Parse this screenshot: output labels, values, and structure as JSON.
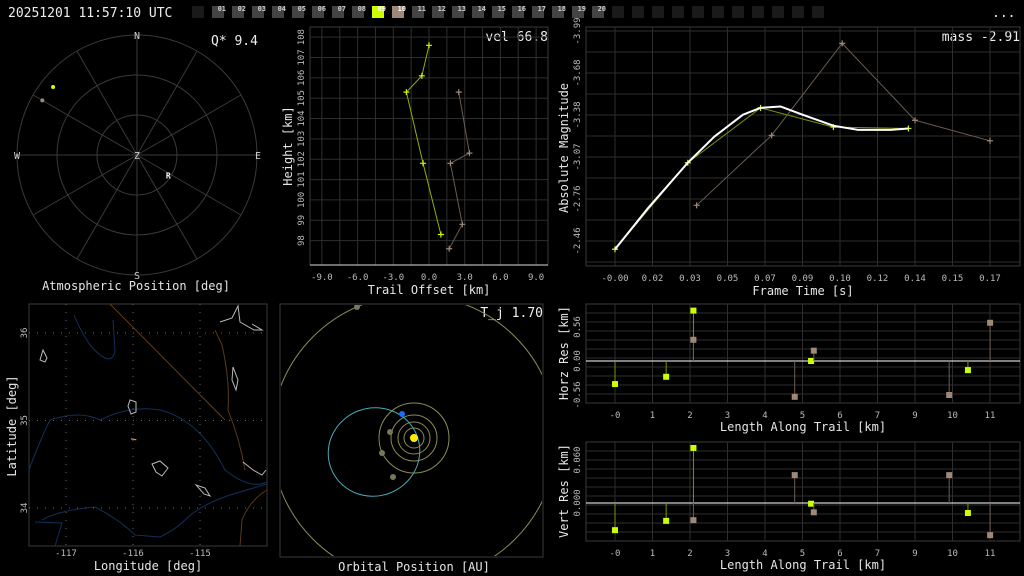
{
  "header": {
    "timestamp": "20251201 11:57:10 UTC",
    "menu_label": "...",
    "cameras": [
      {
        "label": "",
        "state": "empty"
      },
      {
        "label": "01",
        "state": "idle"
      },
      {
        "label": "02",
        "state": "idle"
      },
      {
        "label": "03",
        "state": "idle"
      },
      {
        "label": "04",
        "state": "idle"
      },
      {
        "label": "05",
        "state": "idle"
      },
      {
        "label": "06",
        "state": "idle"
      },
      {
        "label": "07",
        "state": "idle"
      },
      {
        "label": "08",
        "state": "idle"
      },
      {
        "label": "09",
        "state": "primary"
      },
      {
        "label": "10",
        "state": "secondary"
      },
      {
        "label": "11",
        "state": "idle"
      },
      {
        "label": "12",
        "state": "idle"
      },
      {
        "label": "13",
        "state": "idle"
      },
      {
        "label": "14",
        "state": "idle"
      },
      {
        "label": "15",
        "state": "idle"
      },
      {
        "label": "16",
        "state": "idle"
      },
      {
        "label": "17",
        "state": "idle"
      },
      {
        "label": "18",
        "state": "idle"
      },
      {
        "label": "19",
        "state": "idle"
      },
      {
        "label": "20",
        "state": "idle"
      },
      {
        "label": "",
        "state": "empty"
      },
      {
        "label": "",
        "state": "empty"
      },
      {
        "label": "",
        "state": "empty"
      },
      {
        "label": "",
        "state": "empty"
      },
      {
        "label": "",
        "state": "empty"
      },
      {
        "label": "",
        "state": "empty"
      },
      {
        "label": "",
        "state": "empty"
      },
      {
        "label": "",
        "state": "empty"
      },
      {
        "label": "",
        "state": "empty"
      },
      {
        "label": "",
        "state": "empty"
      },
      {
        "label": "",
        "state": "empty"
      }
    ]
  },
  "colors": {
    "primary": "#ccff00",
    "secondary": "#a08878",
    "fit": "#ffffff",
    "grid": "#2e2e2e",
    "orbit": "#8c8c55",
    "comet": "#4aa8b8",
    "earth": "#1a6cff",
    "sun": "#ffee00"
  },
  "chart_data": [
    {
      "id": "polar",
      "type": "scatter",
      "title": "Atmospheric Position [deg]",
      "stat_label": "Q*  9.4",
      "cardinals": {
        "n": "N",
        "s": "S",
        "e": "E",
        "w": "W",
        "zenith": "Z"
      },
      "station_label": "R",
      "station": {
        "azimuth": 123,
        "zenith_angle": 28
      },
      "series": [
        {
          "name": "09",
          "azimuth": [
            309
          ],
          "zenith_angle": [
            81
          ]
        },
        {
          "name": "10",
          "azimuth": [
            300
          ],
          "zenith_angle": [
            82
          ]
        }
      ]
    },
    {
      "id": "trail",
      "type": "line",
      "title": "",
      "stat_label": "vel 66.8",
      "xlabel": "Trail Offset [km]",
      "ylabel": "Height [km]",
      "xlim": [
        -10,
        10
      ],
      "ylim": [
        96.8,
        108.5
      ],
      "xticks": [
        "-9.0",
        "-6.0",
        "-3.0",
        "0.0",
        "3.0",
        "6.0",
        "9.0"
      ],
      "xtick_values": [
        -9,
        -6,
        -3,
        0,
        3,
        6,
        9
      ],
      "yticks": [
        "98",
        "99",
        "100",
        "101",
        "102",
        "103",
        "104",
        "105",
        "106",
        "107",
        "108"
      ],
      "ytick_values": [
        98,
        99,
        100,
        101,
        102,
        103,
        104,
        105,
        106,
        107,
        108
      ],
      "series": [
        {
          "name": "09",
          "x": [
            0.0,
            -0.6,
            -1.9,
            -0.5,
            1.0
          ],
          "y": [
            107.6,
            106.1,
            105.3,
            101.8,
            98.3
          ]
        },
        {
          "name": "10",
          "x": [
            2.5,
            3.4,
            1.8,
            2.8,
            1.7
          ],
          "y": [
            105.3,
            102.3,
            101.8,
            98.8,
            97.6
          ]
        }
      ]
    },
    {
      "id": "magnitude",
      "type": "line",
      "stat_label": "mass -2.91",
      "xlabel": "Frame Time [s]",
      "ylabel": "Absolute Magnitude",
      "xticks": [
        "-0.00",
        "0.02",
        "0.03",
        "0.05",
        "0.07",
        "0.09",
        "0.10",
        "0.12",
        "0.14",
        "0.15",
        "0.17"
      ],
      "yticks": [
        "-3.99",
        "-3.68",
        "-3.38",
        "-3.07",
        "-2.76",
        "-2.46"
      ],
      "xlim": [
        -0.013,
        0.184
      ],
      "ylim": [
        -4.0,
        -2.33
      ],
      "series": [
        {
          "name": "09",
          "x": [
            0.0,
            0.033,
            0.066,
            0.099,
            0.133
          ],
          "y": [
            -2.4,
            -3.03,
            -3.43,
            -3.29,
            -3.28
          ]
        },
        {
          "name": "10",
          "x": [
            0.037,
            0.071,
            0.103,
            0.136,
            0.17
          ],
          "y": [
            -2.72,
            -3.23,
            -3.9,
            -3.34,
            -3.19
          ]
        },
        {
          "name": "fit",
          "x": [
            0.0,
            0.015,
            0.033,
            0.045,
            0.058,
            0.066,
            0.075,
            0.085,
            0.099,
            0.11,
            0.125,
            0.133
          ],
          "y": [
            -2.4,
            -2.7,
            -3.03,
            -3.22,
            -3.38,
            -3.43,
            -3.44,
            -3.38,
            -3.3,
            -3.27,
            -3.27,
            -3.28
          ]
        }
      ]
    },
    {
      "id": "horz_res",
      "type": "scatter",
      "xlabel": "Length Along Trail [km]",
      "ylabel": "Horz Res [km]",
      "xticks": [
        "-0",
        "1",
        "2",
        "3",
        "4",
        "5",
        "6",
        "7",
        "9",
        "10",
        "11"
      ],
      "yticks": [
        "0.56",
        "0.00",
        "-0.56"
      ],
      "ytick_values": [
        0.56,
        0,
        -0.56
      ],
      "ylim": [
        -0.7,
        0.9
      ],
      "series": [
        {
          "name": "09",
          "x": [
            0,
            1.5,
            2.3,
            5.75,
            10.35
          ],
          "y": [
            -0.38,
            -0.26,
            0.83,
            0.0,
            -0.15
          ]
        },
        {
          "name": "10",
          "x": [
            2.3,
            5.27,
            5.83,
            9.8,
            11.0
          ],
          "y": [
            0.35,
            -0.59,
            0.17,
            -0.56,
            0.63
          ]
        }
      ]
    },
    {
      "id": "vert_res",
      "type": "scatter",
      "xlabel": "Length Along Trail [km]",
      "ylabel": "Vert Res [km]",
      "xticks": [
        "-0",
        "1",
        "2",
        "3",
        "4",
        "5",
        "6",
        "7",
        "9",
        "10",
        "11"
      ],
      "yticks": [
        "0.060",
        "0.000"
      ],
      "ytick_values": [
        0.06,
        0.0
      ],
      "ylim": [
        -0.054,
        0.085
      ],
      "series": [
        {
          "name": "09",
          "x": [
            0,
            1.5,
            2.3,
            5.75,
            10.35
          ],
          "y": [
            -0.038,
            -0.025,
            0.077,
            -0.001,
            -0.014
          ]
        },
        {
          "name": "10",
          "x": [
            2.3,
            5.27,
            5.83,
            9.8,
            11.0
          ],
          "y": [
            -0.024,
            0.039,
            -0.013,
            0.039,
            -0.045
          ]
        }
      ]
    },
    {
      "id": "map",
      "type": "map",
      "xlabel": "Longitude [deg]",
      "ylabel": "Latitude [deg]",
      "xticks": [
        "-117",
        "-116",
        "-115"
      ],
      "xtick_values": [
        -117,
        -116,
        -115
      ],
      "yticks": [
        "36",
        "35",
        "34"
      ],
      "ytick_values": [
        36,
        35,
        34
      ],
      "xlim": [
        -117.55,
        -114.0
      ],
      "ylim": [
        33.55,
        36.33
      ],
      "trace": {
        "lon": [
          -116.0,
          -115.98
        ],
        "lat": [
          34.79,
          34.78
        ]
      }
    },
    {
      "id": "orbit",
      "type": "scatter",
      "xlabel": "Orbital Position [AU]",
      "stat_label": "T_j 1.70"
    }
  ]
}
